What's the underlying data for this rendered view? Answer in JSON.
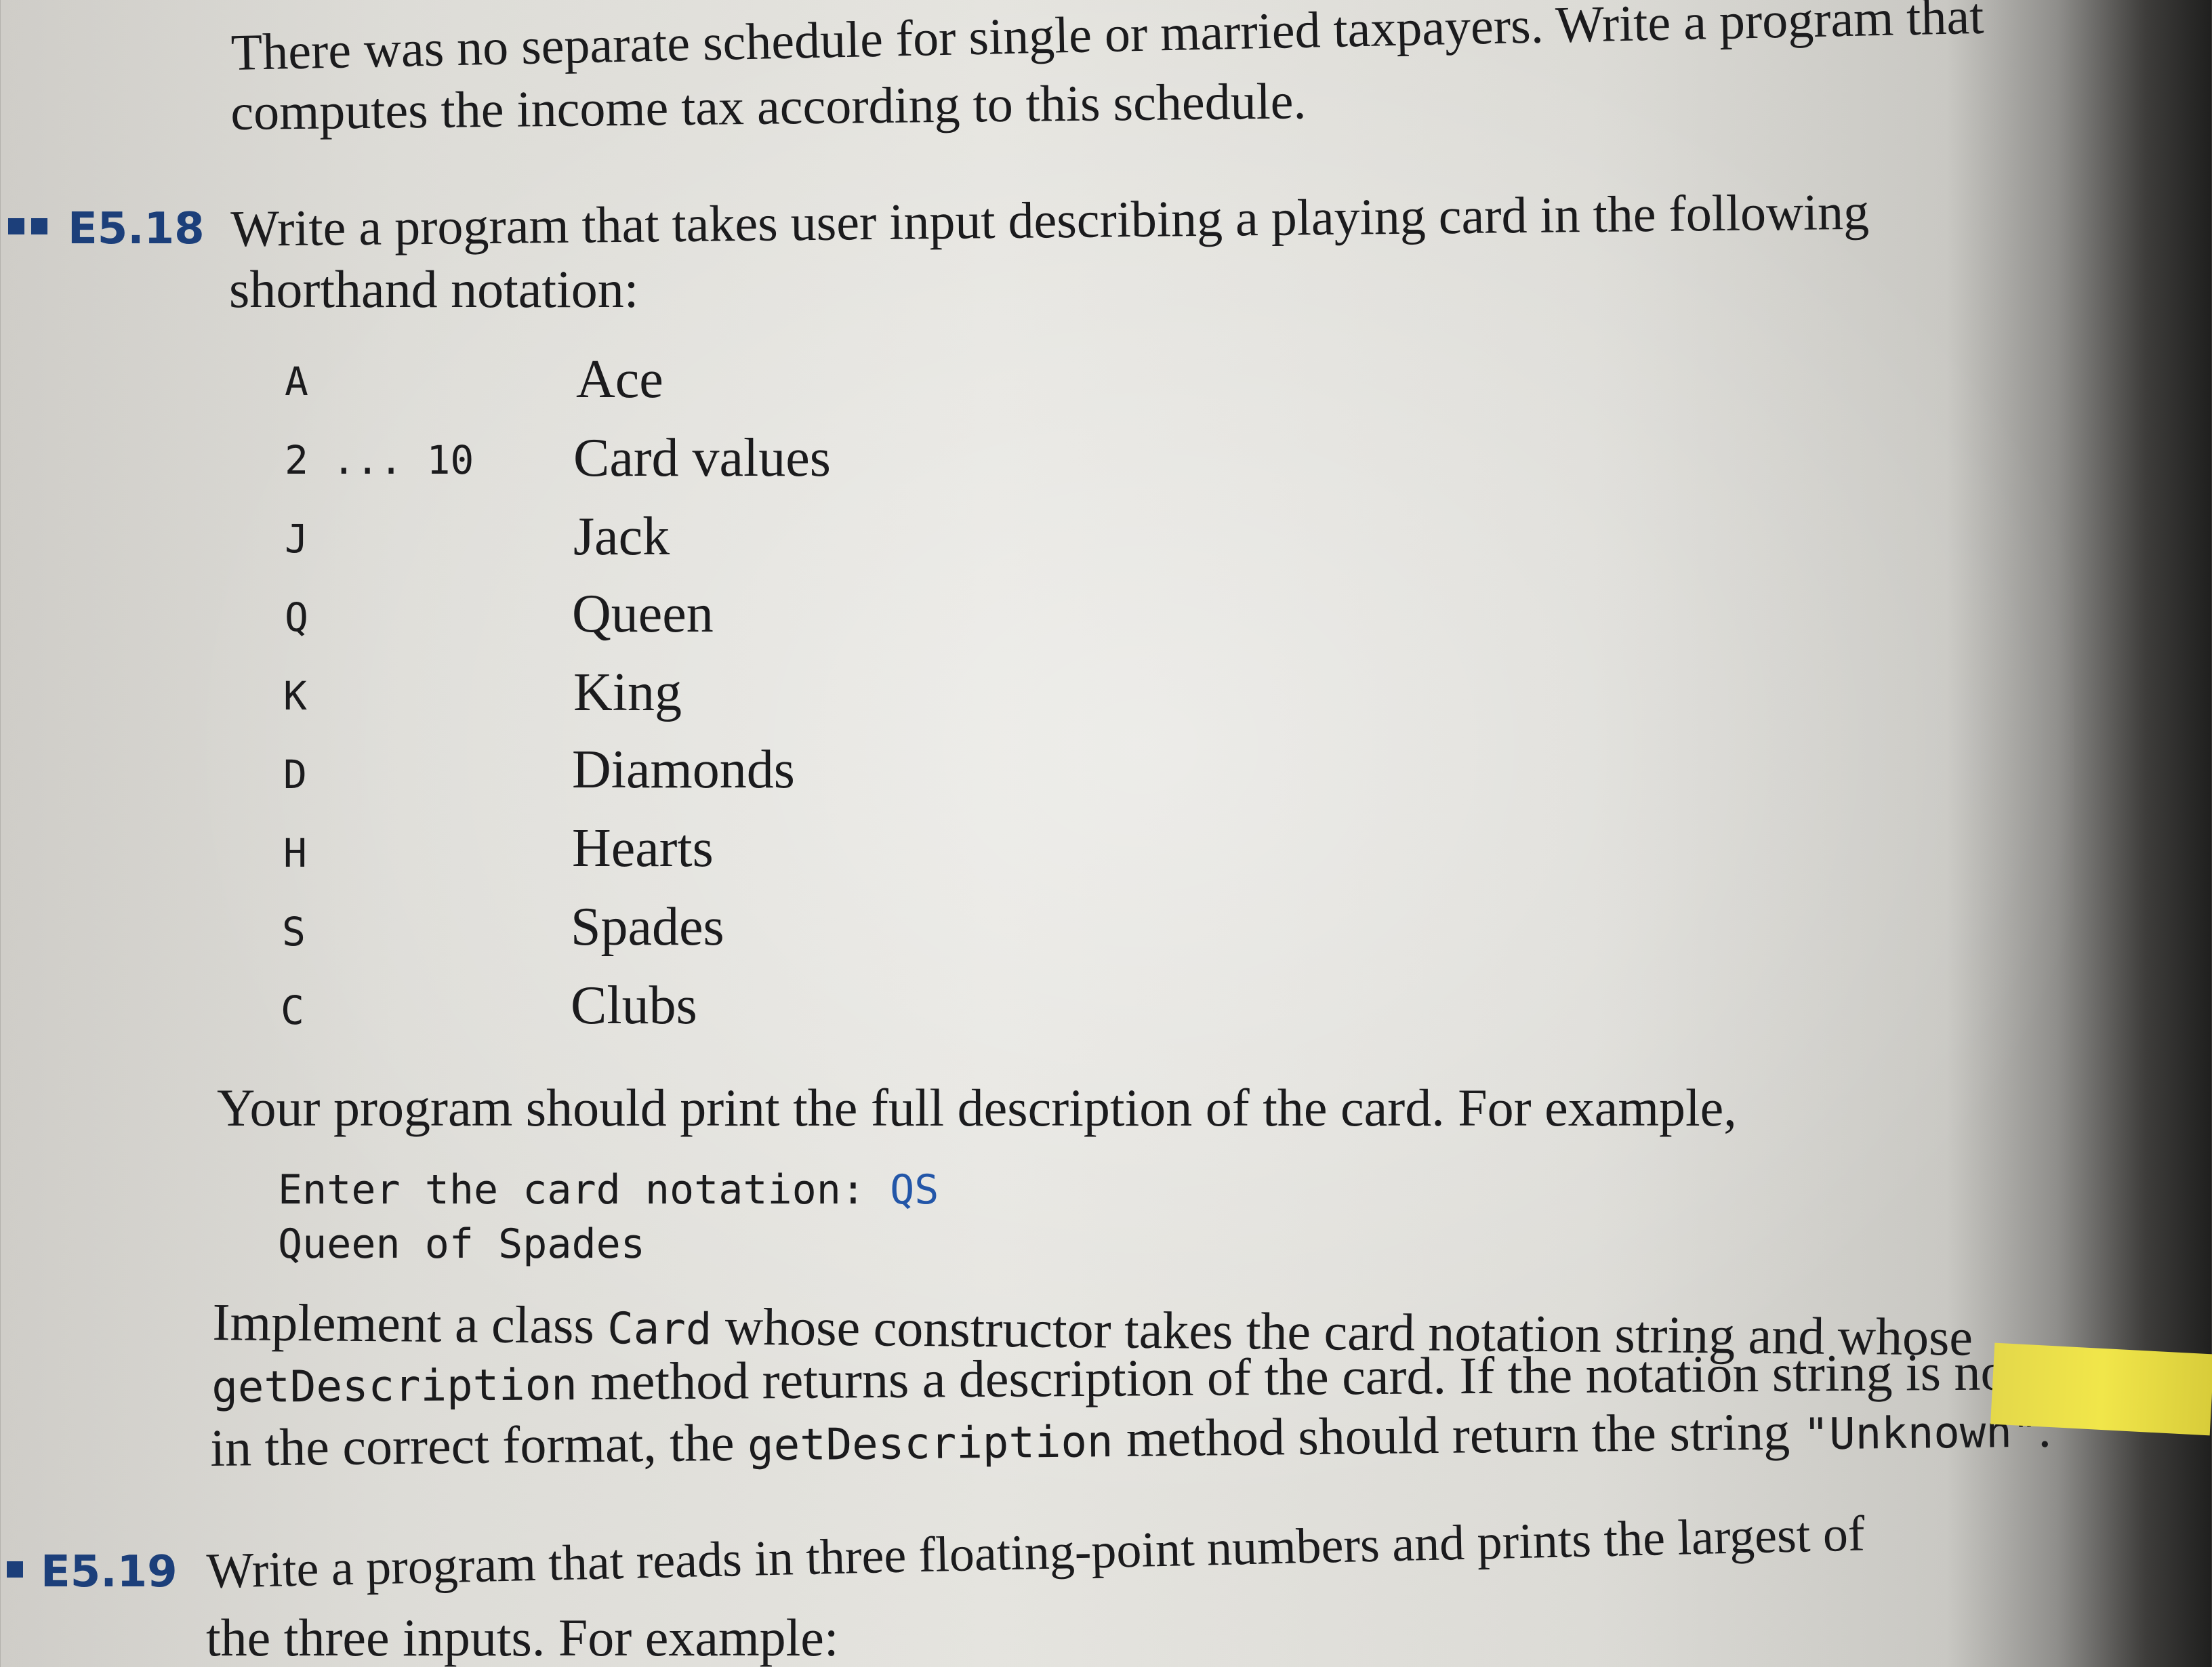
{
  "intro": {
    "line1": "There was no separate schedule for single or married taxpayers. Write a program that",
    "line2": "computes the income tax according to this schedule."
  },
  "e518": {
    "label": "E5.18",
    "prompt_line1": "Write a program that takes user input describing a playing card in the following",
    "prompt_line2": "shorthand notation:",
    "table": [
      {
        "key": "A",
        "value": "Ace"
      },
      {
        "key": "2 ... 10",
        "value": "Card values"
      },
      {
        "key": "J",
        "value": "Jack"
      },
      {
        "key": "Q",
        "value": "Queen"
      },
      {
        "key": "K",
        "value": "King"
      },
      {
        "key": "D",
        "value": "Diamonds"
      },
      {
        "key": "H",
        "value": "Hearts"
      },
      {
        "key": "S",
        "value": "Spades"
      },
      {
        "key": "C",
        "value": "Clubs"
      }
    ],
    "example_intro": "Your program should print the full description of the card. For example,",
    "example_prompt": "Enter the card notation: ",
    "example_input": "QS",
    "example_output": "Queen of Spades",
    "impl": {
      "p1": "Implement a class ",
      "class_name": "Card",
      "p2": " whose constructor takes the card notation string and whose",
      "method1": "getDescription",
      "p3": " method returns a description of the card. If the notation string is not",
      "p4": "in the correct format, the ",
      "method2": "getDescription",
      "p5": " method should return the string ",
      "unknown": "\"Unknown\"",
      "p6": "."
    }
  },
  "e519": {
    "label": "E5.19",
    "prompt_line1": "Write a program that reads in three floating-point numbers and prints the largest of",
    "prompt_line2": "the three inputs. For example:"
  }
}
